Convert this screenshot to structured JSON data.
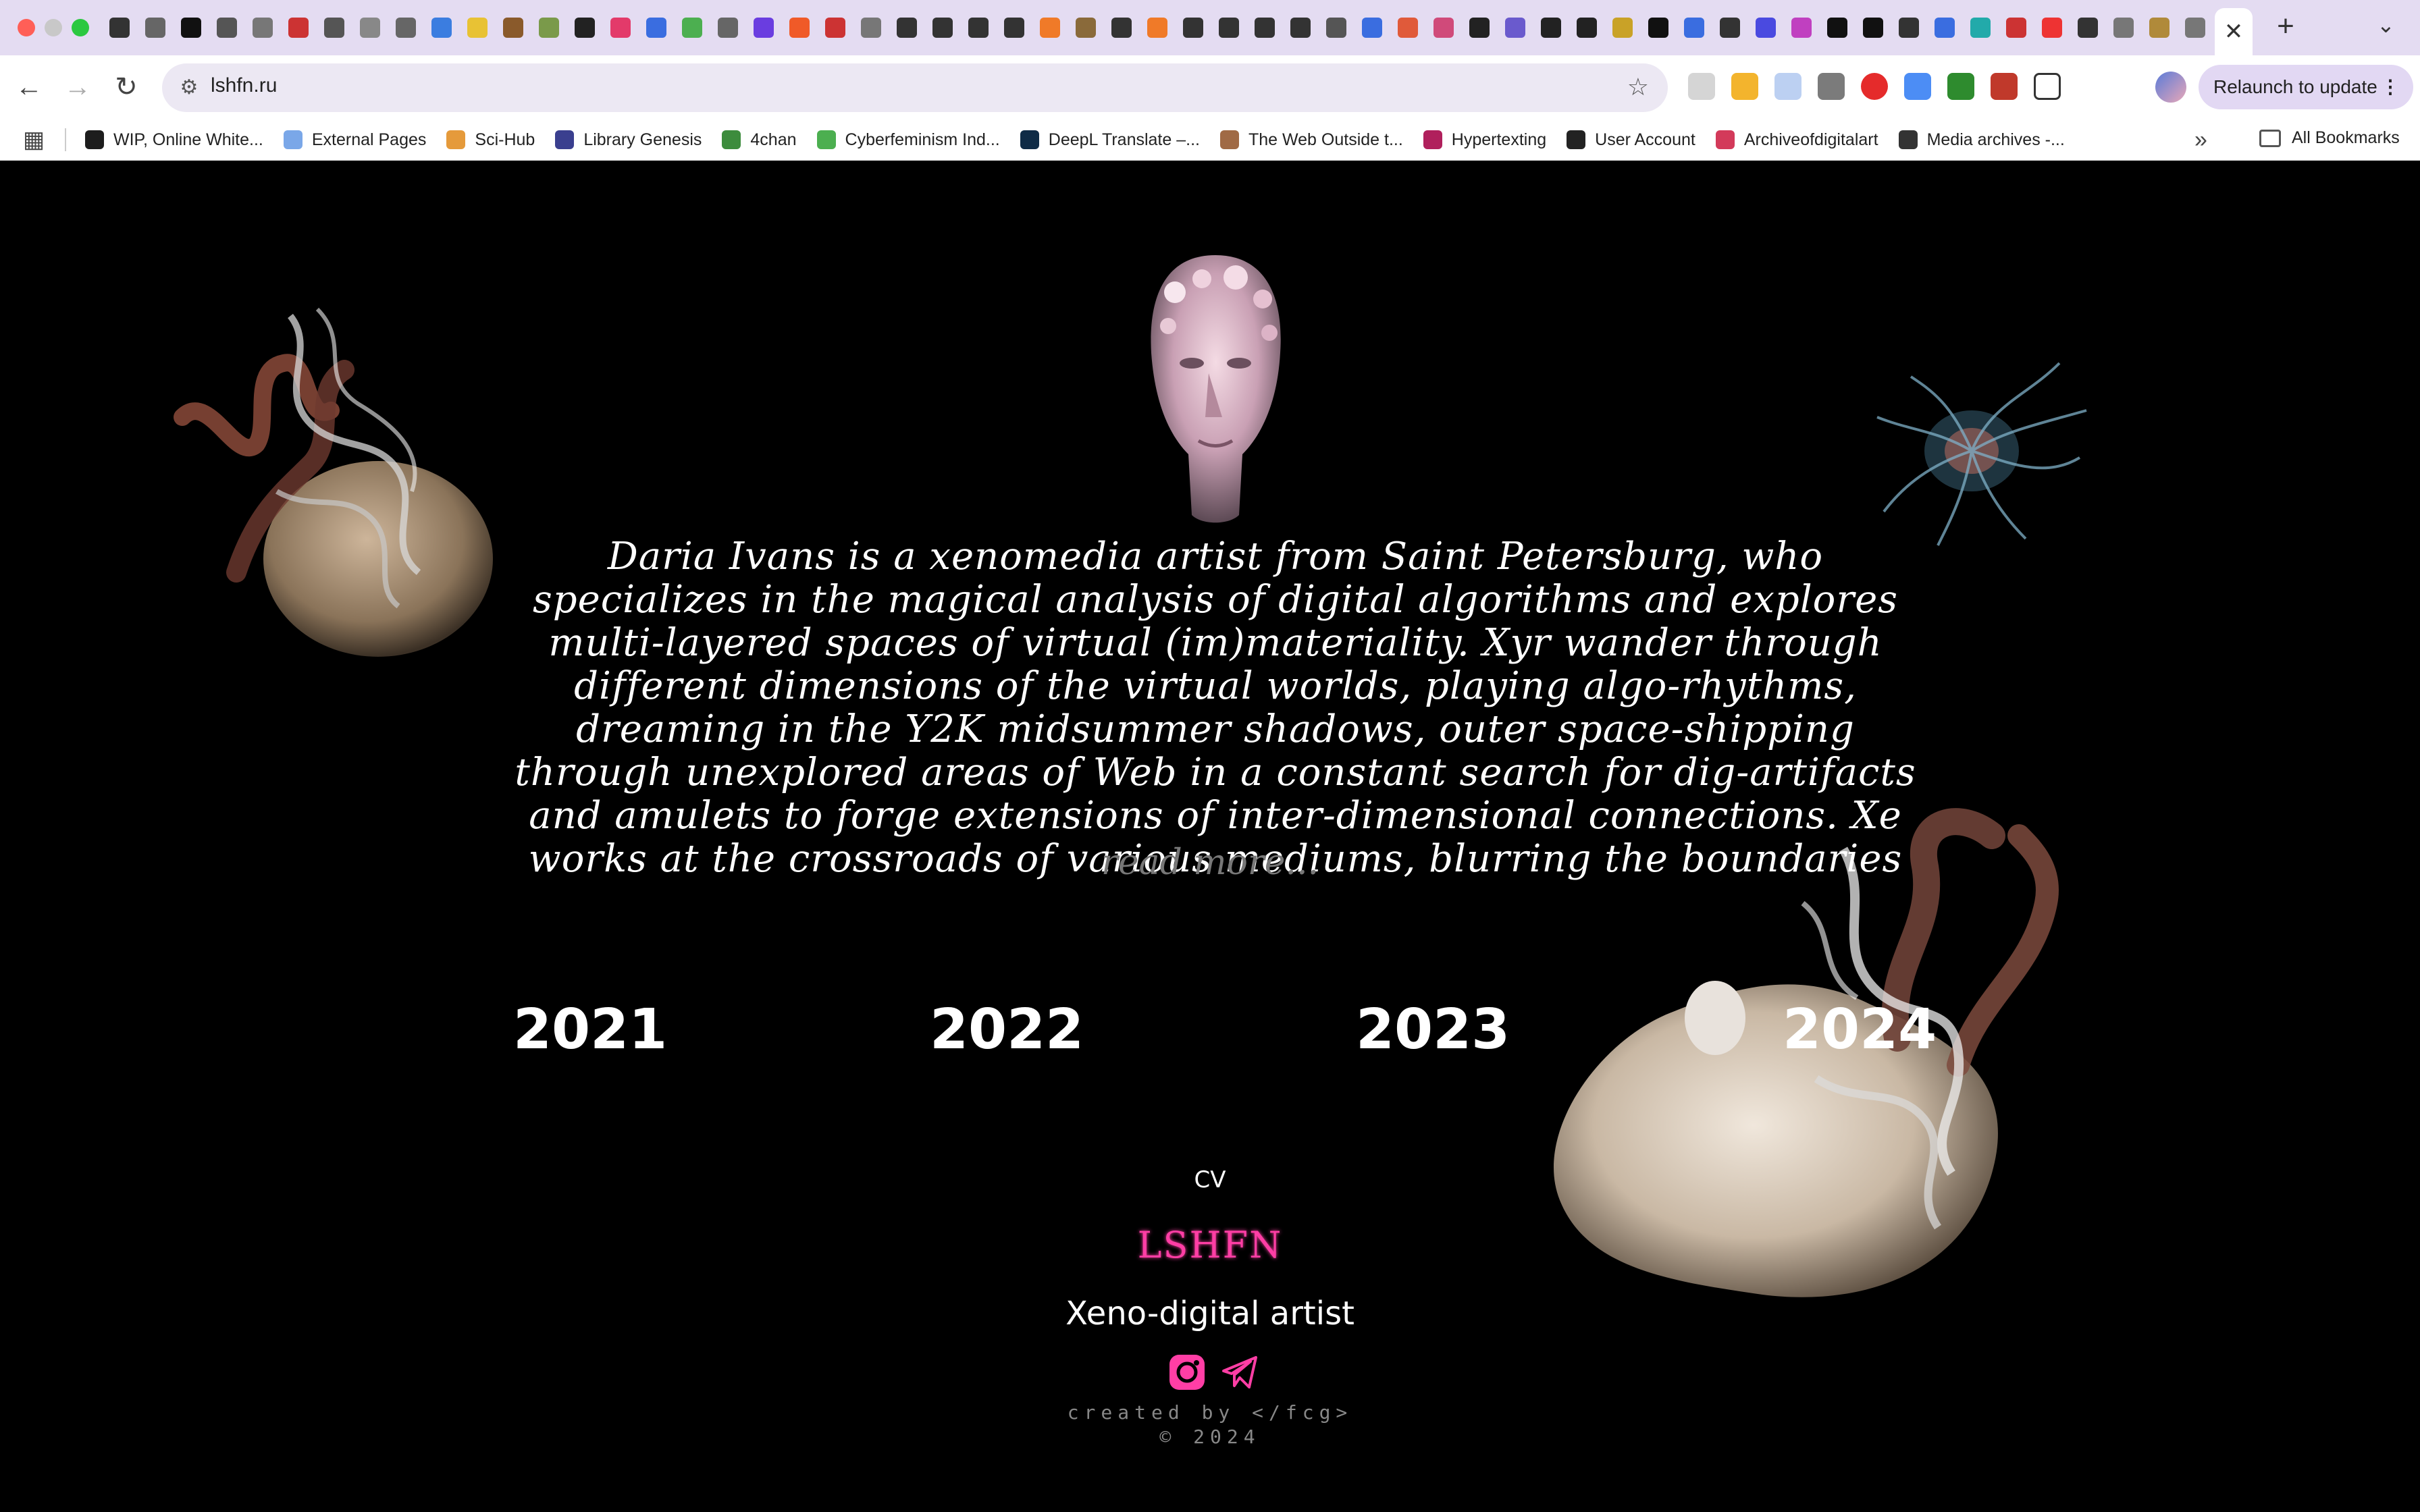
{
  "browser": {
    "url": "lshfn.ru",
    "relaunch_label": "Relaunch to update",
    "active_tab_close": "✕",
    "new_tab": "+",
    "bookmarks": [
      {
        "label": "WIP, Online White...",
        "color": "#1d1d1d"
      },
      {
        "label": "External Pages",
        "color": "#7aa7e8"
      },
      {
        "label": "Sci-Hub",
        "color": "#e59a3b"
      },
      {
        "label": "Library Genesis",
        "color": "#3a3f8f"
      },
      {
        "label": "4chan",
        "color": "#3d8c3d"
      },
      {
        "label": "Cyberfeminism Ind...",
        "color": "#4caf50"
      },
      {
        "label": "DeepL Translate –...",
        "color": "#0f2b46"
      },
      {
        "label": "The Web Outside t...",
        "color": "#a06a45"
      },
      {
        "label": "Hypertexting",
        "color": "#b0205c"
      },
      {
        "label": "User Account",
        "color": "#222222"
      },
      {
        "label": "Archiveofdigitalart",
        "color": "#d33a5a"
      },
      {
        "label": "Media archives -...",
        "color": "#333333"
      }
    ],
    "all_bookmarks": "All Bookmarks"
  },
  "page": {
    "bio": "Daria Ivans is a xenomedia artist from Saint Petersburg, who specializes in the magical analysis of digital algorithms and explores multi-layered spaces of virtual (im)materiality. Xyr wander through different dimensions of the virtual worlds, playing algo-rhythms, dreaming in the Y2K midsummer shadows, outer space-shipping through unexplored areas of Web in a constant search for dig-artifacts and amulets to forge extensions of inter-dimensional connections. Xe works at the crossroads of various mediums, blurring the boundaries",
    "read_more": "read more...",
    "years": [
      "2021",
      "2022",
      "2023",
      "2024"
    ],
    "cv": "CV",
    "logo": "LSHFN",
    "tagline": "Xeno-digital artist",
    "credits": "created by </fcg>",
    "copyright": "© 2024",
    "accent_color": "#ff3ea5"
  }
}
